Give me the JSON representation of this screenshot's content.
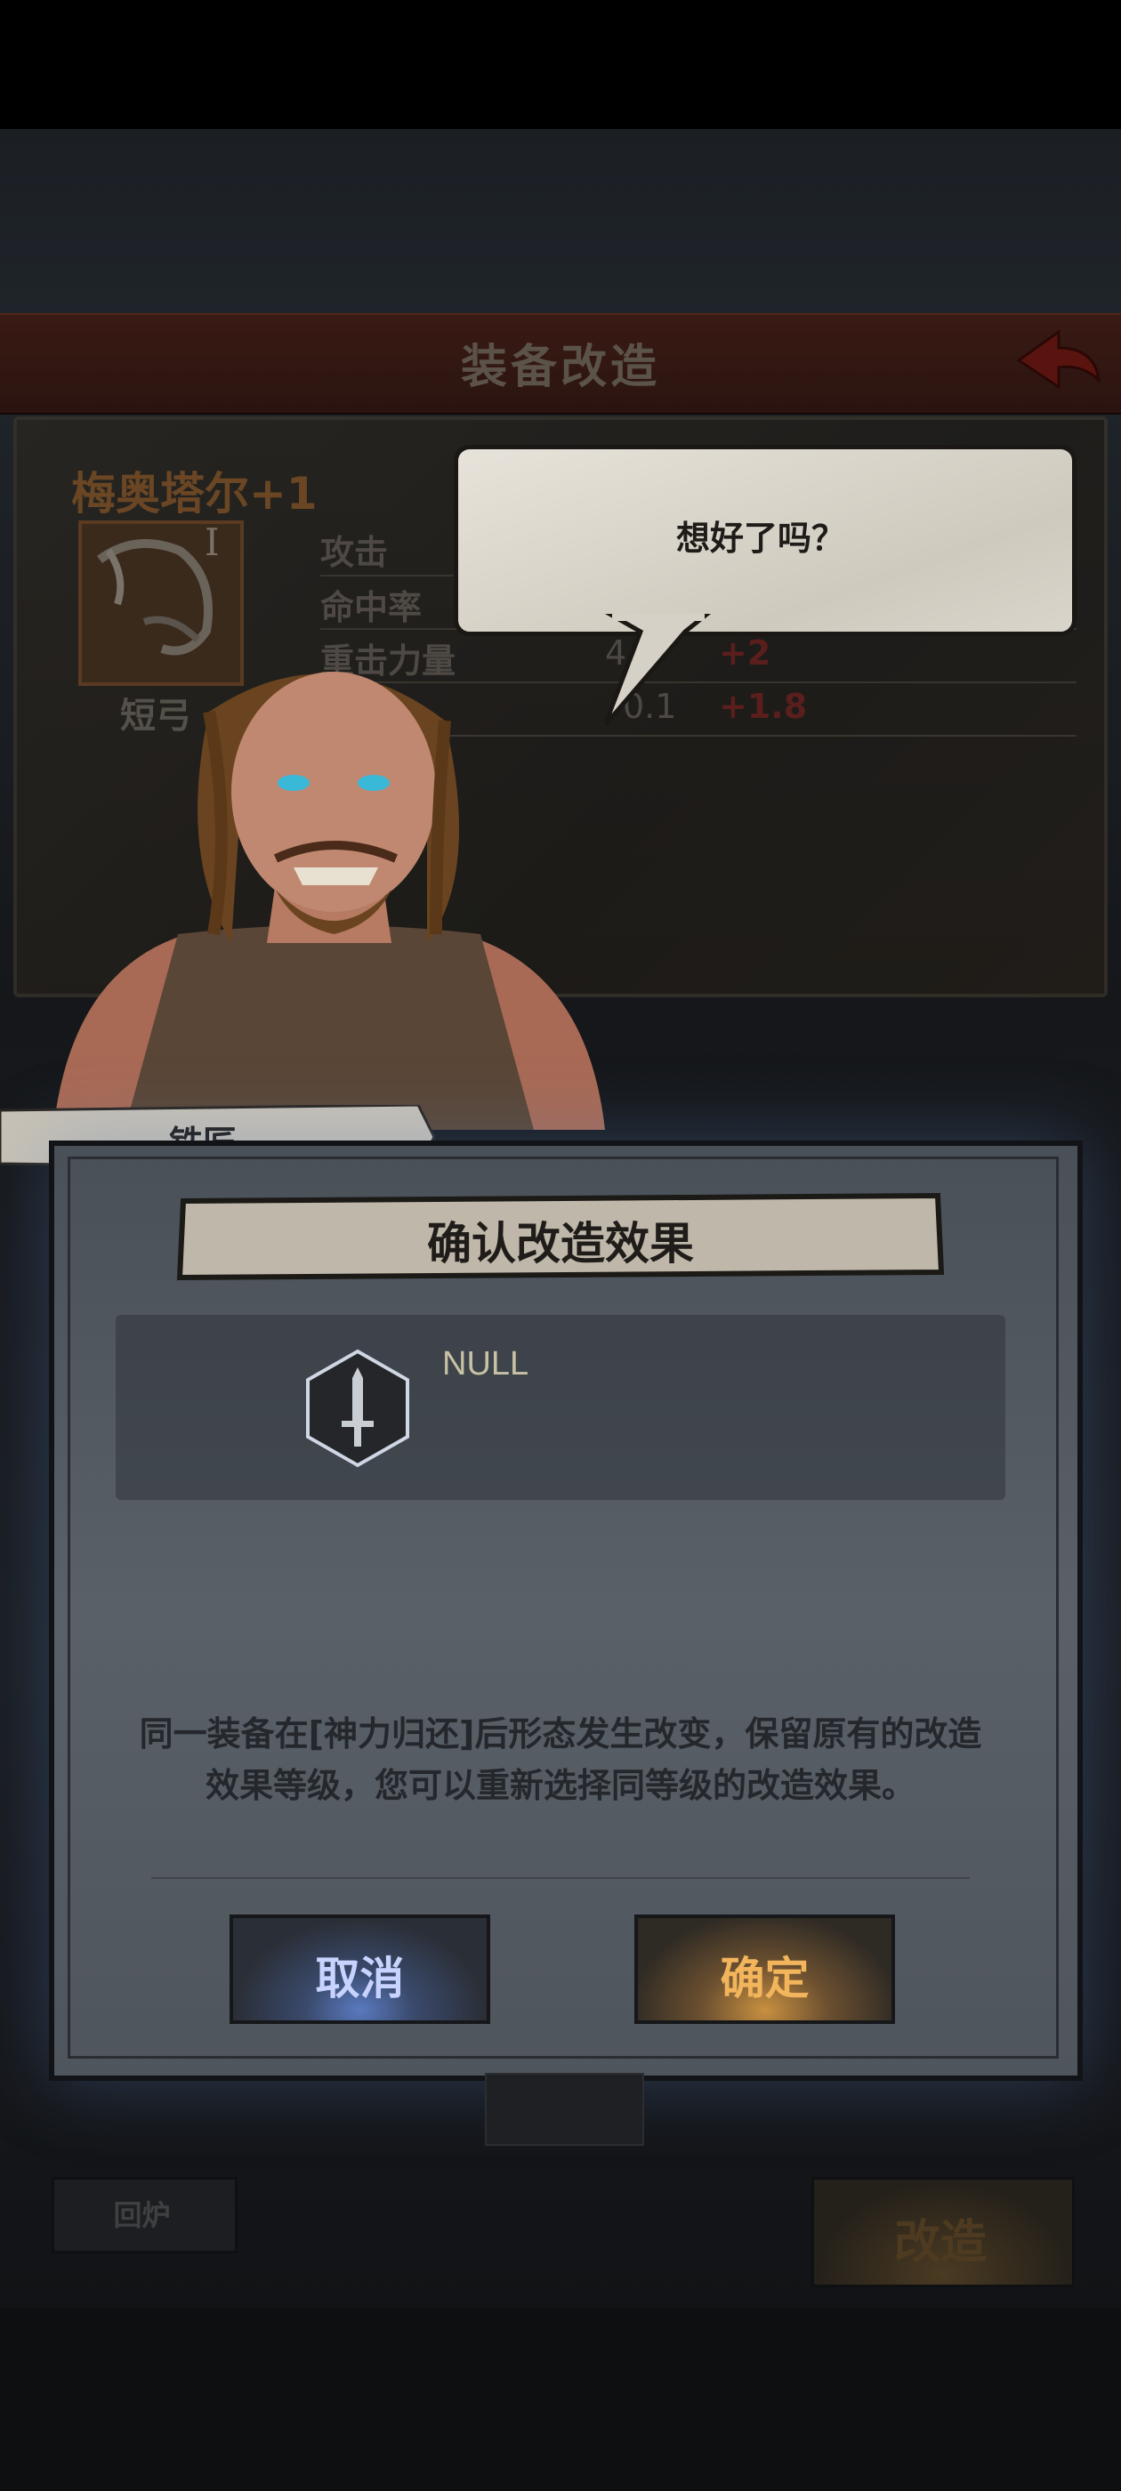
{
  "header": {
    "title": "装备改造"
  },
  "equipment": {
    "name": "梅奥塔尔+1",
    "tier": "I",
    "type": "短弓",
    "stats": [
      {
        "label": "攻击",
        "value": "",
        "bonus": ""
      },
      {
        "label": "命中率",
        "value": "",
        "bonus": ""
      },
      {
        "label": "重击力量",
        "value": "4",
        "bonus": "+2"
      },
      {
        "label": "",
        "value": "0.1",
        "bonus": "+1.8"
      }
    ]
  },
  "npc": {
    "speech": "想好了吗？",
    "name": "铁匠"
  },
  "dialog": {
    "title": "确认改造效果",
    "effect": {
      "icon": "dagger-icon",
      "name": "NULL"
    },
    "description_line1": "同一装备在[神力归还]后形态发生改变，保留原有的改造",
    "description_line2": "效果等级，您可以重新选择同等级的改造效果。",
    "cancel_label": "取消",
    "confirm_label": "确定"
  },
  "bottom": {
    "recycle_label": "回炉",
    "modify_label": "改造"
  },
  "colors": {
    "cancel_glow": "#5a7ac0",
    "confirm_glow": "#c89040",
    "header": "#3a1a14"
  }
}
